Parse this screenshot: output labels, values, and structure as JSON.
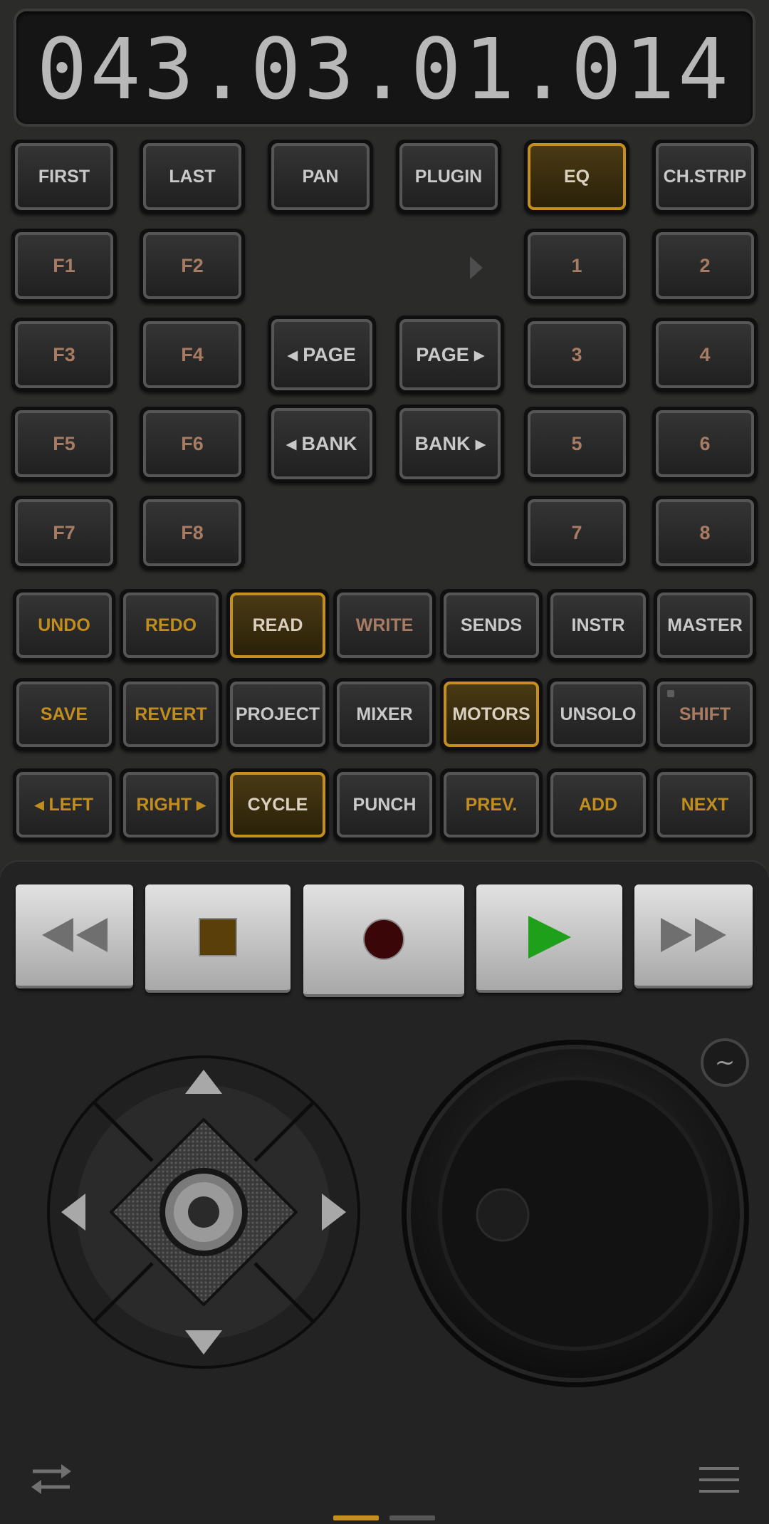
{
  "timecode": "043.03.01.014",
  "row_nav": [
    {
      "label": "FIRST",
      "color": "light",
      "active": false
    },
    {
      "label": "LAST",
      "color": "light",
      "active": false
    },
    {
      "label": "PAN",
      "color": "light",
      "active": false
    },
    {
      "label": "PLUGIN",
      "color": "light",
      "active": false
    },
    {
      "label": "EQ",
      "color": "light",
      "active": true
    },
    {
      "label": "CH.STRIP",
      "color": "light",
      "active": false
    }
  ],
  "function_keys": [
    "F1",
    "F2",
    "F3",
    "F4",
    "F5",
    "F6",
    "F7",
    "F8"
  ],
  "page_bank": {
    "page_left": "◂ PAGE",
    "page_right": "PAGE ▸",
    "bank_left": "◂ BANK",
    "bank_right": "BANK ▸"
  },
  "numbers": [
    "1",
    "2",
    "3",
    "4",
    "5",
    "6",
    "7",
    "8"
  ],
  "row_edit": [
    {
      "label": "UNDO",
      "color": "orange",
      "active": false
    },
    {
      "label": "REDO",
      "color": "orange",
      "active": false
    },
    {
      "label": "READ",
      "color": "light",
      "active": true
    },
    {
      "label": "WRITE",
      "color": "brown",
      "active": false
    },
    {
      "label": "SENDS",
      "color": "light",
      "active": false
    },
    {
      "label": "INSTR",
      "color": "light",
      "active": false
    },
    {
      "label": "MASTER",
      "color": "light",
      "active": false
    }
  ],
  "row_session": [
    {
      "label": "SAVE",
      "color": "orange",
      "active": false
    },
    {
      "label": "REVERT",
      "color": "orange",
      "active": false
    },
    {
      "label": "PROJECT",
      "color": "light",
      "active": false
    },
    {
      "label": "MIXER",
      "color": "light",
      "active": false
    },
    {
      "label": "MOTORS",
      "color": "light",
      "active": true
    },
    {
      "label": "UNSOLO",
      "color": "light",
      "active": false
    },
    {
      "label": "SHIFT",
      "color": "brown",
      "active": false
    }
  ],
  "row_locate": [
    {
      "label": "◂ LEFT",
      "color": "orange",
      "active": false
    },
    {
      "label": "RIGHT ▸",
      "color": "orange",
      "active": false
    },
    {
      "label": "CYCLE",
      "color": "light",
      "active": true
    },
    {
      "label": "PUNCH",
      "color": "light",
      "active": false
    },
    {
      "label": "PREV.",
      "color": "orange",
      "active": false
    },
    {
      "label": "ADD",
      "color": "orange",
      "active": false
    },
    {
      "label": "NEXT",
      "color": "orange",
      "active": false
    }
  ],
  "transport": [
    {
      "name": "rewind",
      "icon": "rewind-icon"
    },
    {
      "name": "stop",
      "icon": "stop-icon"
    },
    {
      "name": "record",
      "icon": "record-icon"
    },
    {
      "name": "play",
      "icon": "play-icon"
    },
    {
      "name": "fast-forward",
      "icon": "fast-forward-icon"
    }
  ],
  "scrub_symbol": "~",
  "colors": {
    "accent": "#c48f1c",
    "orange_text": "#c18d1f",
    "brown_text": "#a87b63",
    "play_green": "#1fa01a",
    "record_red": "#3a0608",
    "stop_brown": "#5a3f08"
  },
  "page_indicator": {
    "count": 2,
    "current": 1
  }
}
